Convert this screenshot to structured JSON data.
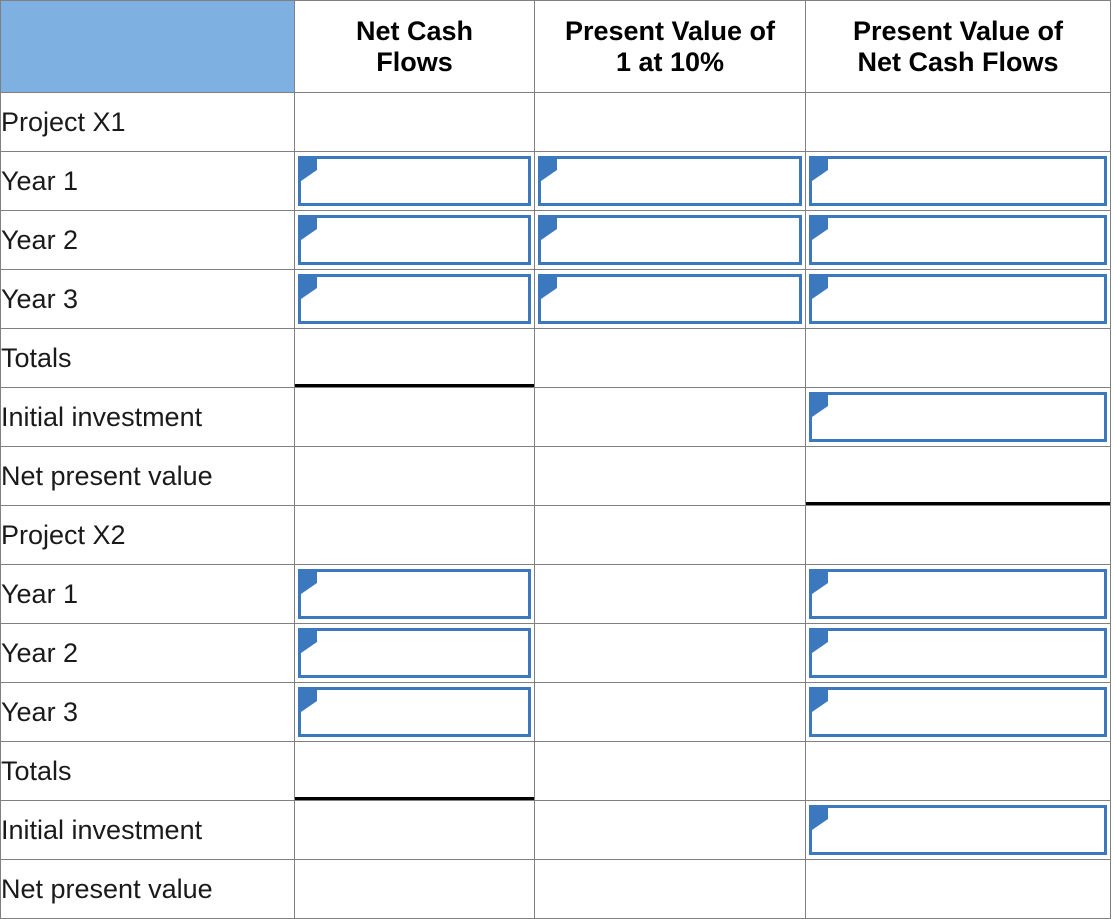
{
  "table": {
    "columns": [
      {
        "key": "label",
        "header": ""
      },
      {
        "key": "ncf",
        "header": "Net Cash\nFlows"
      },
      {
        "key": "pv1",
        "header": "Present Value of\n1 at 10%"
      },
      {
        "key": "pvncf",
        "header": "Present Value of\nNet Cash Flows"
      }
    ],
    "header_lines": {
      "col0": "",
      "col1_line1": "Net Cash",
      "col1_line2": "Flows",
      "col2_line1": "Present Value of",
      "col2_line2": "1 at 10%",
      "col3_line1": "Present Value of",
      "col3_line2": "Net Cash Flows"
    },
    "rows": [
      {
        "label": "Project X1",
        "ncf": "",
        "pv1": "",
        "pvncf": ""
      },
      {
        "label": "Year 1",
        "ncf": "",
        "pv1": "",
        "pvncf": ""
      },
      {
        "label": "Year 2",
        "ncf": "",
        "pv1": "",
        "pvncf": ""
      },
      {
        "label": "Year 3",
        "ncf": "",
        "pv1": "",
        "pvncf": ""
      },
      {
        "label": "Totals",
        "ncf": "",
        "pv1": "",
        "pvncf": ""
      },
      {
        "label": "Initial investment",
        "ncf": "",
        "pv1": "",
        "pvncf": ""
      },
      {
        "label": "Net present value",
        "ncf": "",
        "pv1": "",
        "pvncf": ""
      },
      {
        "label": "Project X2",
        "ncf": "",
        "pv1": "",
        "pvncf": ""
      },
      {
        "label": "Year 1",
        "ncf": "",
        "pv1": "",
        "pvncf": ""
      },
      {
        "label": "Year 2",
        "ncf": "",
        "pv1": "",
        "pvncf": ""
      },
      {
        "label": "Year 3",
        "ncf": "",
        "pv1": "",
        "pvncf": ""
      },
      {
        "label": "Totals",
        "ncf": "",
        "pv1": "",
        "pvncf": ""
      },
      {
        "label": "Initial investment",
        "ncf": "",
        "pv1": "",
        "pvncf": ""
      },
      {
        "label": "Net present value",
        "ncf": "",
        "pv1": "",
        "pvncf": ""
      }
    ],
    "row_labels": {
      "r0": "Project X1",
      "r1": "Year 1",
      "r2": "Year 2",
      "r3": "Year 3",
      "r4": "Totals",
      "r5": "Initial investment",
      "r6": "Net present value",
      "r7": "Project X2",
      "r8": "Year 1",
      "r9": "Year 2",
      "r10": "Year 3",
      "r11": "Totals",
      "r12": "Initial investment",
      "r13": "Net present value"
    },
    "input_values": {
      "x1_y1_ncf": "",
      "x1_y1_pv1": "",
      "x1_y1_pvncf": "",
      "x1_y2_ncf": "",
      "x1_y2_pv1": "",
      "x1_y2_pvncf": "",
      "x1_y3_ncf": "",
      "x1_y3_pv1": "",
      "x1_y3_pvncf": "",
      "x1_init_pvncf": "",
      "x2_y1_ncf": "",
      "x2_y1_pvncf": "",
      "x2_y2_ncf": "",
      "x2_y2_pvncf": "",
      "x2_y3_ncf": "",
      "x2_y3_pvncf": "",
      "x2_init_pvncf": ""
    },
    "colors": {
      "header_fill": "#7FB0E2",
      "entry_border": "#3B78BE",
      "flag_marker": "#3B78BE",
      "grid_line": "#808080",
      "total_rule": "#000000",
      "cell_fill": "#FFFFFF",
      "text": "#1A1A1A"
    }
  }
}
